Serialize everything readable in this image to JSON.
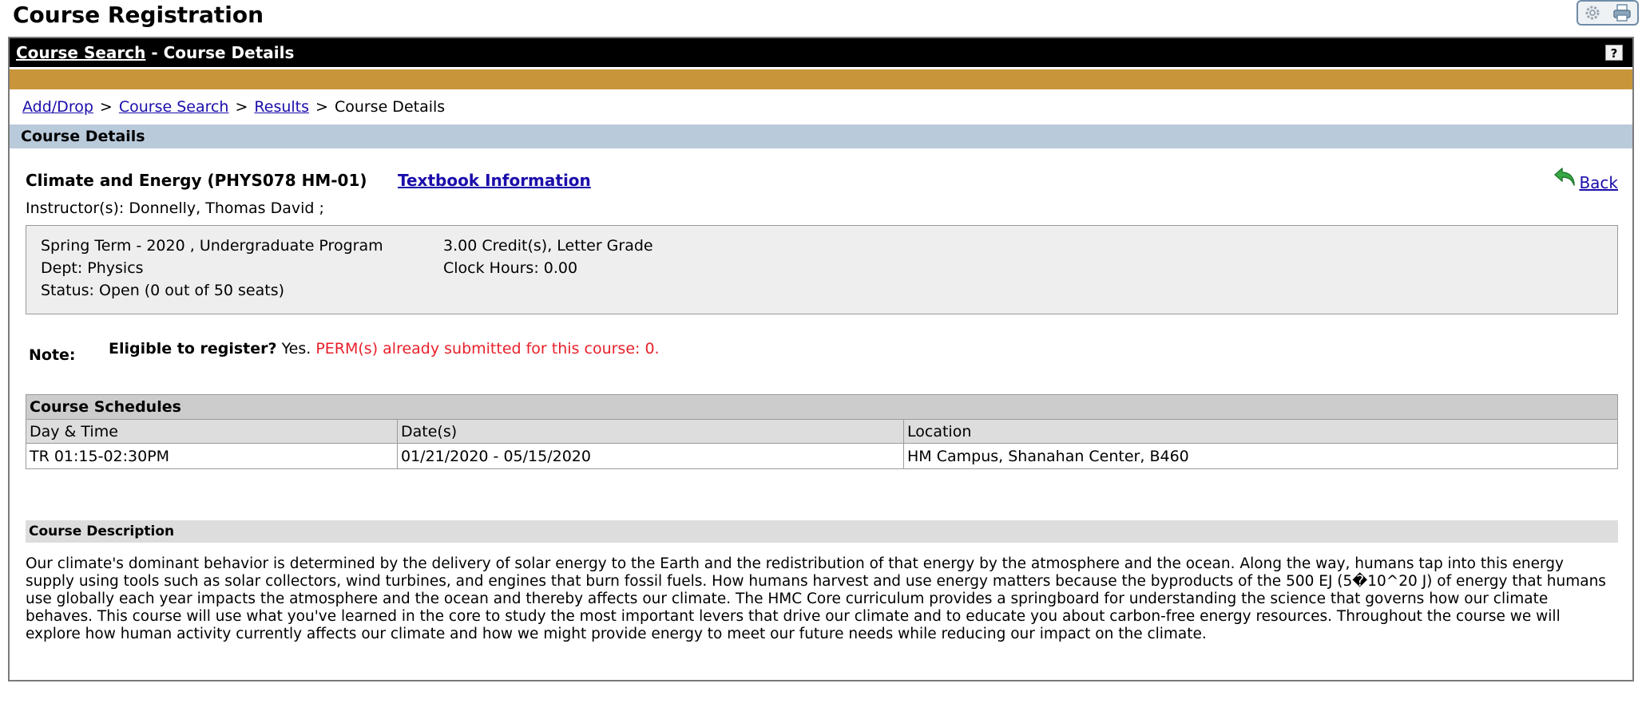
{
  "page": {
    "title": "Course Registration"
  },
  "toolbar": {
    "settings_icon": "gear-icon",
    "print_icon": "printer-icon"
  },
  "titlebar": {
    "link_label": "Course Search",
    "suffix": " - Course Details",
    "help_label": "?"
  },
  "breadcrumb": {
    "items": [
      "Add/Drop",
      "Course Search",
      "Results",
      "Course Details"
    ],
    "separator": ">"
  },
  "section": {
    "title": "Course Details"
  },
  "course": {
    "name": "Climate and Energy (PHYS078 HM-01)",
    "textbook_link": "Textbook Information",
    "back_label": "Back",
    "instructor": "Instructor(s): Donnelly, Thomas David ;",
    "term": "Spring Term - 2020 , Undergraduate Program",
    "dept": "Dept: Physics",
    "status": "Status: Open (0 out of 50 seats)",
    "credits": "3.00 Credit(s), Letter Grade",
    "clock_hours": "Clock Hours: 0.00"
  },
  "note": {
    "label": "Note:",
    "eligible_label": "Eligible to register?",
    "eligible_value": " Yes. ",
    "perm_text": "PERM(s) already submitted for this course: 0."
  },
  "schedules": {
    "title": "Course Schedules",
    "columns": [
      "Day & Time",
      "Date(s)",
      "Location"
    ],
    "rows": [
      [
        "TR 01:15-02:30PM",
        "01/21/2020 - 05/15/2020",
        "HM Campus, Shanahan Center, B460"
      ]
    ]
  },
  "description": {
    "title": "Course Description",
    "text": "Our climate's dominant behavior is determined by the delivery of solar energy to the Earth and the redistribution of that energy by the atmosphere and the ocean. Along the way, humans tap into this energy supply using tools such as solar collectors, wind turbines, and engines that burn fossil fuels. How humans harvest and use energy matters because the byproducts of the 500 EJ (5�10^20 J) of energy that humans use globally each year impacts the atmosphere and the ocean and thereby affects our climate. The HMC Core curriculum provides a springboard for understanding the science that governs how our climate behaves. This course will use what you've learned in the core to study the most important levers that drive our climate and to educate you about carbon-free energy resources. Throughout the course we will explore how human activity currently affects our climate and how we might provide energy to meet our future needs while reducing our impact on the climate."
  },
  "colors": {
    "titlebar": "#000000",
    "goldbar": "#c9953a",
    "section_bar": "#b9cadb",
    "link": "#1a0dab",
    "perm_text": "#e8202a"
  }
}
